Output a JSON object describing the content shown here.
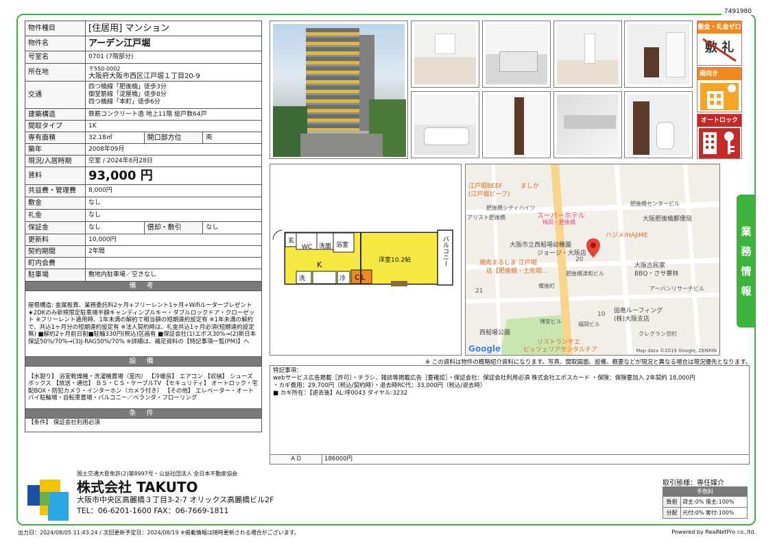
{
  "doc_id": "7491980",
  "property": {
    "type_label": "物件種目",
    "type_value": "[住居用] マンション",
    "name_label": "物件名",
    "name_value": "アーデン江戸堀",
    "room_label": "号室名",
    "room_value": "0701 (7階部分)",
    "location_label": "所在地",
    "postal": "〒550-0002",
    "address": "大阪府大阪市西区江戸堀１丁目20-9",
    "traffic_label": "交通",
    "traffic": [
      "四つ橋線「肥後橋」徒歩3分",
      "御堂筋線「淀屋橋」徒歩8分",
      "四つ橋線「本町」徒歩6分"
    ],
    "structure_label": "建築構造",
    "structure_value": "鉄筋コンクリート造 地上11階 総戸数64戸",
    "layout_label": "間取タイプ",
    "layout_value": "1K",
    "area_label": "専有面積",
    "area_value": "32.18㎡",
    "direction_label": "開口部方位",
    "direction_value": "南",
    "built_label": "築年",
    "built_value": "2008年09月",
    "status_label": "現況/入居時期",
    "status_value": "空室 / 2024年8月28日",
    "rent_label": "賃料",
    "rent_value": "93,000 円",
    "common_label": "共益費・管理費",
    "common_value": "8,000円",
    "deposit_label": "敷金",
    "deposit_value": "なし",
    "keymoney_label": "礼金",
    "keymoney_value": "なし",
    "guarantee_label": "保証金",
    "guarantee_value": "なし",
    "amort_label": "償却・敷引",
    "amort_value": "なし",
    "renewal_label": "更新料",
    "renewal_value": "10,000円",
    "contract_label": "契約期間",
    "contract_value": "2年間",
    "town_label": "町内会費",
    "town_value": "",
    "parking_label": "駐車場",
    "parking_value": "敷地内駐車場／空きなし"
  },
  "sections": {
    "notes_title": "備 考",
    "notes_text": "屋根構造: 金属板葺、業務委託料2ヶ月+フリーレント1ヶ月+Wifiルータープレゼント★2DKのみ新規限定駐車場半額キャンディンプルキー・ダブルロックドア・クローゼット ※フリーレント適用時、1年未満の解約で相当額の短期違約設定有 ※1年未満の解約で、共込1ヶ月分の短期違約設定有 ※法人契約時は、礼金共込1ヶ月必須(短期違約設定無) ■解約2ヶ月前日割■駐輪330円(税込)区画有 ■保証会社(1)エポス30%→(2)新日本保証50%/70%→(3)J-RAG50%/70% ※詳細は、補足資料の【特記事項一覧(PM)】へ",
    "equip_title": "設 備",
    "equip_text": "【水廻り】 浴室乾燥機・洗濯機置場（室内） 【冷暖房】 エアコン 【収納】 シューズボックス 【放送・通信】 ＢＳ・ＣＳ・ケーブルTV 【セキュリティ】 オートロック・宅配BOX・防犯カメラ・インターホン（カメラ付き） 【その他】 エレベーター・オートバイ駐輪場・自転車置場・バルコニー／ベランダ・フローリング",
    "cond_title": "条 件",
    "cond_text": "【条件】 保証会社利用必須"
  },
  "badges": {
    "b1": "敷金・礼金ゼロ",
    "b1_main": "敷 礼",
    "b2": "南向き",
    "b3": "オートロック"
  },
  "side_tab": [
    "業",
    "務",
    "情",
    "報"
  ],
  "floorplan": {
    "genkan": "玄",
    "wc": "WC",
    "sen": "洗面",
    "bath": "浴室",
    "k": "K",
    "wash": "洗",
    "cool": "冷",
    "cl": "ＣＬ",
    "room": "洋室10.2帖",
    "balcony": "バルコニー"
  },
  "map": {
    "labels": [
      "江戸堀BEEF",
      "(江戸堀ビーフ)",
      "ましか",
      "肥後橋シティハイツ",
      "アリスト肥後橋",
      "スーパーホテル",
      "梅田・肥後橋",
      "肥後橋センタービル",
      "大阪肥後橋郵便局",
      "ハジメ/HAJIME",
      "大阪市立西船場幼稚園",
      "ジョージ・大阪店",
      "焼肉まるしま 江戸堀",
      "店【肥後橋・土佐堀...",
      "肥後橋津和ビル",
      "大阪古民家",
      "BBQ・さサ華林",
      "アーバンリサーチビル",
      "備後町",
      "田島ルーフィング",
      "(株)大阪支店",
      "博安ビル",
      "福岡ビル",
      "クレグラン京町",
      "西船場公園",
      "リストランテエ",
      "ピッツェリアサンタルチア"
    ],
    "nums": [
      "20",
      "21",
      "10"
    ],
    "google": "Google",
    "copyright": "Map data ©2019 Google, ZENRIN"
  },
  "disclaimer": "※ この資料は物件の概略紹介資料になります。写真、間取図面、設備、概要などが現況と異なる場合は現況優先となります。",
  "remarks": {
    "title": "特記事項：",
    "line1": "webサービス広告掲載［許可］・チラシ、雑誌等掲載広告［要確認］・保証会社：保証会社利用必須 株式会社エポスカード ・保険：保険要加入 2年契約 18,000円",
    "line2": "・カギ費用：29,700円（税込/契約時）・退去時RC代：33,000円（税込/退去時）",
    "line3": "■ カギ所在：【退去後】AL:呼0043 ダイヤル:3232",
    "ad_label": "ＡＤ",
    "ad_value": "186000円"
  },
  "company": {
    "license": "国土交通大臣免許(2)第8997号・公益社団法人 全日本不動産協会",
    "name": "株式会社 TAKUTO",
    "address": "大阪市中央区高麗橋３丁目3-2-7 オリックス高麗橋ビル2F",
    "tel": "TEL：06-6201-1600 FAX：06-7669-1811"
  },
  "transaction": {
    "label": "取引態様：専任媒介",
    "fee_title": "手数料",
    "burden_label": "負担",
    "burden_value": "貸主:0% 借主:100%",
    "split_label": "分配",
    "split_value": "元付:0% 客付:100%"
  },
  "footer": {
    "left": "出力日：2024/08/05 11:43:24 / 次回更新予定日：2024/08/19 ※掲載情報は随時更新される場合がございます。",
    "right": "Powered by RealNetPro co.,ltd."
  },
  "colors": {
    "green": "#3db33d",
    "orange": "#f08a1c",
    "red": "#c62828",
    "yellow": "#f5e942"
  }
}
